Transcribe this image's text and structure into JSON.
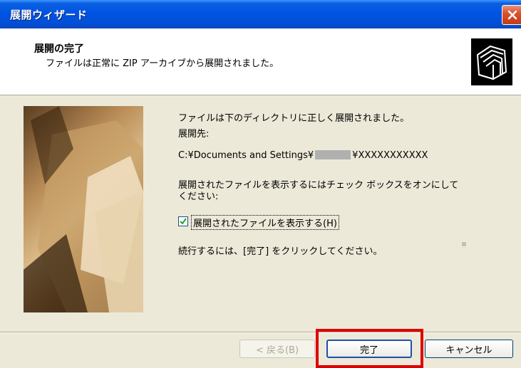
{
  "window": {
    "title": "展開ウィザード"
  },
  "header": {
    "title": "展開の完了",
    "subtitle": "ファイルは正常に ZIP アーカイブから展開されました。",
    "icon": "folder-stack-icon"
  },
  "body": {
    "line1": "ファイルは下のディレクトリに正しく展開されました。",
    "dest_label": "展開先:",
    "path_prefix": "C:¥Documents and Settings¥",
    "path_suffix": "¥XXXXXXXXXXX",
    "show_line1": "展開されたファイルを表示するにはチェック ボックスをオンにして",
    "show_line2": "ください:",
    "checkbox_label": "展開されたファイルを表示する(H)",
    "checkbox_checked": true,
    "continue_text": "続行するには、[完了] をクリックしてください。"
  },
  "buttons": {
    "back": "< 戻る(B)",
    "finish": "完了",
    "cancel": "キャンセル"
  },
  "colors": {
    "titlebar": "#0054e3",
    "highlight": "#e00000",
    "close": "#d9532e"
  }
}
